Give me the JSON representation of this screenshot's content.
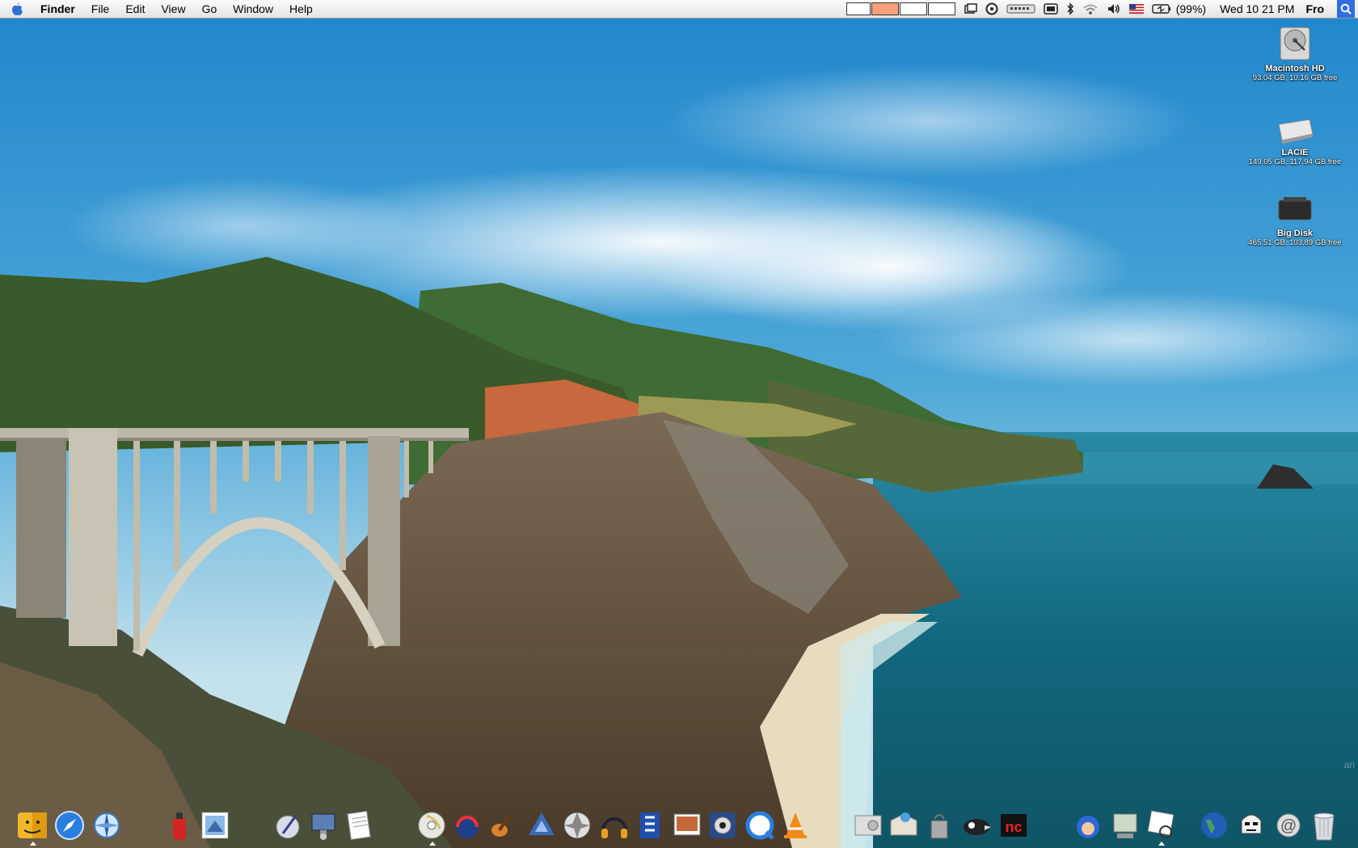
{
  "menubar": {
    "app_name": "Finder",
    "menus": [
      "File",
      "Edit",
      "View",
      "Go",
      "Window",
      "Help"
    ],
    "battery_percent": "(99%)",
    "clock": "Wed 10 21 PM",
    "user": "Fro",
    "status_icons": [
      "spaces-icon",
      "window-icon",
      "sync-icon",
      "keyboard-icon",
      "display-icon",
      "bluetooth-icon",
      "wifi-icon",
      "volume-icon",
      "us-flag-icon",
      "battery-icon",
      "spotlight-icon"
    ]
  },
  "desktop": {
    "disks": [
      {
        "name": "Macintosh HD",
        "info": "93.04 GB, 10.16 GB free"
      },
      {
        "name": "LACIE",
        "info": "149.05 GB, 117.94 GB free"
      },
      {
        "name": "Big Disk",
        "info": "465.51 GB, 103.89 GB free"
      }
    ],
    "corner_text": "ari"
  },
  "dock": {
    "apps": [
      "finder-icon",
      "safari-icon",
      "compass-icon",
      "fire-extinguisher-icon",
      "mail-stamp-icon",
      "script-editor-icon",
      "network-utility-icon",
      "textedit-icon",
      "dvd-player-icon",
      "speedtest-icon",
      "garageband-icon",
      "recycle-icon",
      "aperture-icon",
      "audio-icon",
      "blue-app-icon",
      "iphoto-icon",
      "photo-booth-icon",
      "quicktime-icon",
      "vlc-icon",
      "disk-utility-icon",
      "archive-icon",
      "smoke-icon",
      "cyberduck-icon",
      "nc-icon",
      "megaman-icon",
      "network-icon",
      "preview-icon",
      "globe-icon",
      "stormtrooper-icon",
      "at-mail-icon",
      "trash-icon"
    ]
  },
  "colors": {
    "sky_top": "#2d8fd0",
    "sky_bottom": "#c6e3ee",
    "ocean": "#1a7a90",
    "hill": "#3b5a2c",
    "menubar": "#f0f0f0",
    "active_space": "#f8a07a"
  }
}
